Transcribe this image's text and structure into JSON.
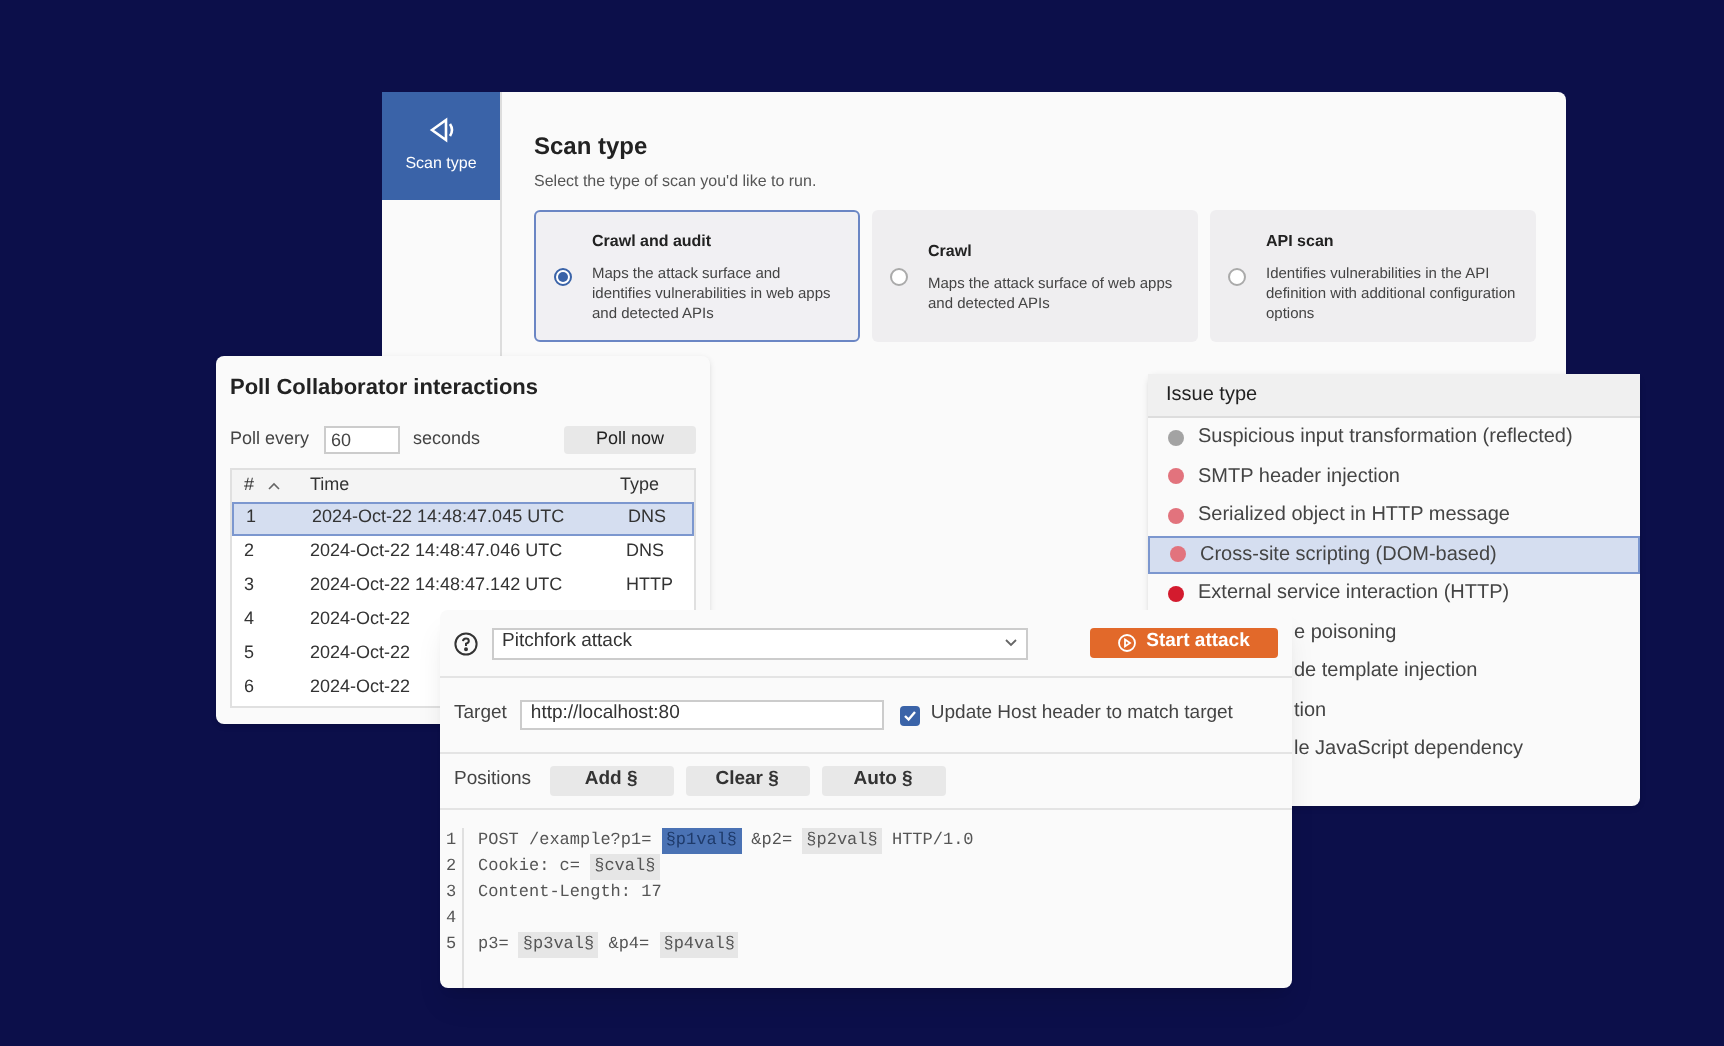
{
  "scan_window": {
    "sidebar_tab": {
      "label": "Scan type",
      "selected": true
    },
    "title": "Scan type",
    "subtitle": "Select the type of scan you'd like to run.",
    "options": [
      {
        "title": "Crawl and audit",
        "description": "Maps the attack surface and identifies vulnerabilities in web apps and detected APIs",
        "selected": true
      },
      {
        "title": "Crawl",
        "description": "Maps the attack surface of web apps and detected APIs",
        "selected": false
      },
      {
        "title": "API scan",
        "description": "Identifies vulnerabilities in the API definition with additional configuration options",
        "selected": false
      }
    ]
  },
  "poll_window": {
    "title": "Poll Collaborator interactions",
    "poll_label": "Poll every",
    "interval": "60",
    "unit": "seconds",
    "poll_button": "Poll now",
    "columns": [
      "#",
      "Time",
      "Type"
    ],
    "rows": [
      {
        "number": "1",
        "time": "2024-Oct-22 14:48:47.045 UTC",
        "type": "DNS",
        "selected": true
      },
      {
        "number": "2",
        "time": "2024-Oct-22 14:48:47.046 UTC",
        "type": "DNS",
        "selected": false
      },
      {
        "number": "3",
        "time": "2024-Oct-22 14:48:47.142 UTC",
        "type": "HTTP",
        "selected": false
      },
      {
        "number": "4",
        "time": "2024-Oct-22",
        "selected": false
      },
      {
        "number": "5",
        "time": "2024-Oct-22",
        "selected": false
      },
      {
        "number": "6",
        "time": "2024-Oct-22",
        "selected": false
      }
    ]
  },
  "issue_window": {
    "title": "Issue type",
    "items": [
      {
        "label": "Suspicious input transformation (reflected)",
        "color": "#a3a3a3",
        "selected": false
      },
      {
        "label": "SMTP header injection",
        "color": "#e2737d",
        "selected": false
      },
      {
        "label": "Serialized object in HTTP message",
        "color": "#e2737d",
        "selected": false
      },
      {
        "label": "Cross-site scripting (DOM-based)",
        "color": "#e2737d",
        "selected": true
      },
      {
        "label": "External service interaction (HTTP)",
        "color": "#d31b2e",
        "selected": false
      }
    ],
    "partly_hidden_items": [
      "e poisoning",
      "de template injection",
      "tion",
      "le JavaScript dependency"
    ]
  },
  "attack_window": {
    "attack_type": "Pitchfork attack",
    "start_button": "Start attack",
    "target_label": "Target",
    "target": "http://localhost:80",
    "update_host": {
      "label": "Update Host header to match target",
      "checked": true
    },
    "positions_label": "Positions",
    "position_buttons": [
      "Add §",
      "Clear §",
      "Auto §"
    ],
    "lines": [
      {
        "number": "1",
        "segments": [
          {
            "text": "POST /example?p1= ",
            "kind": "plain"
          },
          {
            "text": "§p1val§",
            "kind": "marker",
            "selected": true
          },
          {
            "text": " &p2= ",
            "kind": "plain"
          },
          {
            "text": "§p2val§",
            "kind": "marker",
            "selected": false
          },
          {
            "text": " HTTP/1.0",
            "kind": "plain"
          }
        ]
      },
      {
        "number": "2",
        "segments": [
          {
            "text": "Cookie: c= ",
            "kind": "plain"
          },
          {
            "text": "§cval§",
            "kind": "marker",
            "selected": false
          }
        ]
      },
      {
        "number": "3",
        "segments": [
          {
            "text": "Content-Length: 17",
            "kind": "plain"
          }
        ]
      },
      {
        "number": "4"
      },
      {
        "number": "5",
        "segments": [
          {
            "text": "p3= ",
            "kind": "plain"
          },
          {
            "text": "§p3val§",
            "kind": "marker",
            "selected": false
          },
          {
            "text": " &p4= ",
            "kind": "plain"
          },
          {
            "text": "§p4val§",
            "kind": "marker",
            "selected": false
          }
        ]
      }
    ]
  }
}
